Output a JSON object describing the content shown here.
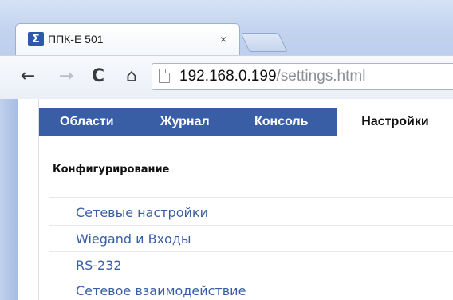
{
  "browser": {
    "tab": {
      "favicon": "Σ",
      "title": "ППК-Е 501",
      "close_label": "×"
    },
    "toolbar": {
      "back_icon": "←",
      "forward_icon": "→",
      "reload_icon": "C",
      "home_icon": "⌂"
    },
    "url": {
      "host": "192.168.0.199",
      "path": "/settings.html"
    }
  },
  "page": {
    "nav_tabs": [
      {
        "label": "Области"
      },
      {
        "label": "Журнал"
      },
      {
        "label": "Консоль"
      },
      {
        "label": "Настройки",
        "active": true
      }
    ],
    "section_title": "Конфигурирование",
    "links": [
      {
        "label": "Сетевые настройки"
      },
      {
        "label": "Wiegand и Входы"
      },
      {
        "label": "RS-232"
      },
      {
        "label": "Сетевое взаимодействие"
      }
    ]
  },
  "colors": {
    "navbar": "#3a5ea6",
    "link": "#3a5ea6",
    "chrome": "#c2d3ef"
  }
}
